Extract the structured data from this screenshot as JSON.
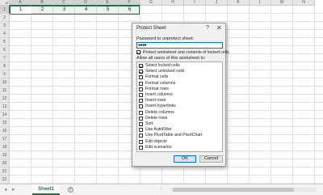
{
  "grid": {
    "columns": [
      "A",
      "B",
      "C",
      "D",
      "E",
      "F",
      "G",
      "H",
      "I",
      "J",
      "K",
      "L",
      "M",
      "N"
    ],
    "rows": [
      "1",
      "2",
      "3",
      "4",
      "5",
      "6",
      "7",
      "8",
      "9",
      "10",
      "11",
      "12",
      "13",
      "14",
      "15",
      "16",
      "17",
      "18",
      "19",
      "20",
      "21",
      "22"
    ],
    "row1_values": [
      "1",
      "2",
      "3",
      "4",
      "5",
      "6"
    ]
  },
  "sheetbar": {
    "prev_icon": "◂",
    "next_icon": "▸",
    "sheet_tab": "Sheet1",
    "add_icon": "+",
    "dots": "⋮"
  },
  "dialog": {
    "title": "Protect Sheet",
    "help_icon": "?",
    "close_icon": "✕",
    "password_label": "Password to unprotect sheet:",
    "password_value": "●●●●",
    "protect_checkbox_label": "Protect worksheet and contents of locked cells",
    "protect_checked": true,
    "allow_label": "Allow all users of this worksheet to:",
    "permissions": [
      {
        "label": "Select locked cells",
        "checked": true
      },
      {
        "label": "Select unlocked cells",
        "checked": true
      },
      {
        "label": "Format cells",
        "checked": false
      },
      {
        "label": "Format columns",
        "checked": false
      },
      {
        "label": "Format rows",
        "checked": false
      },
      {
        "label": "Insert columns",
        "checked": false
      },
      {
        "label": "Insert rows",
        "checked": false
      },
      {
        "label": "Insert hyperlinks",
        "checked": false
      },
      {
        "label": "Delete columns",
        "checked": false
      },
      {
        "label": "Delete rows",
        "checked": false
      },
      {
        "label": "Sort",
        "checked": false
      },
      {
        "label": "Use AutoFilter",
        "checked": false
      },
      {
        "label": "Use PivotTable and PivotChart",
        "checked": false
      },
      {
        "label": "Edit objects",
        "checked": false
      },
      {
        "label": "Edit scenarios",
        "checked": false
      }
    ],
    "ok_label": "OK",
    "cancel_label": "Cancel"
  },
  "colors": {
    "accent": "#217346",
    "focus": "#0078d7"
  }
}
